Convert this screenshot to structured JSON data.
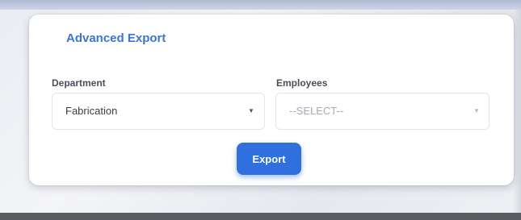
{
  "panel": {
    "title": "Advanced Export"
  },
  "fields": {
    "department": {
      "label": "Department",
      "value": "Fabrication"
    },
    "employees": {
      "label": "Employees",
      "placeholder": "--SELECT--"
    }
  },
  "actions": {
    "export_label": "Export"
  },
  "icons": {
    "dropdown": "chevron-down-icon"
  },
  "colors": {
    "accent": "#2f6fde",
    "title": "#3b74d6"
  }
}
